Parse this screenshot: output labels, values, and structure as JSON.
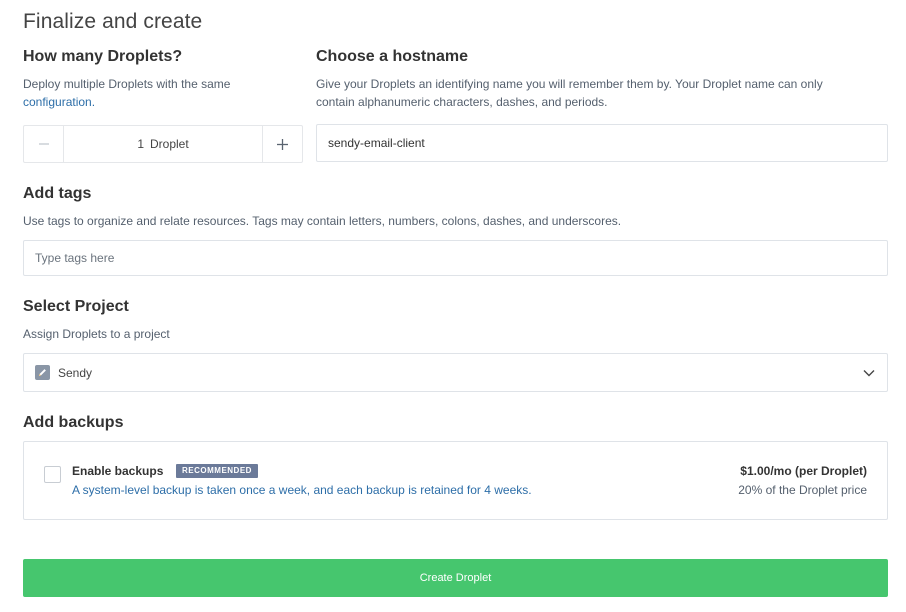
{
  "page": {
    "title": "Finalize and create"
  },
  "droplets": {
    "heading": "How many Droplets?",
    "description_prefix": "Deploy multiple Droplets with the same",
    "description_link": "configuration.",
    "minus_icon": "minus-icon",
    "plus_icon": "plus-icon",
    "count": "1",
    "unit": "Droplet"
  },
  "hostname": {
    "heading": "Choose a hostname",
    "description_line1": "Give your Droplets an identifying name you will remember them by. Your Droplet name can only",
    "description_line2": "contain alphanumeric characters, dashes, and periods.",
    "value": "sendy-email-client"
  },
  "tags": {
    "heading": "Add tags",
    "description": "Use tags to organize and relate resources. Tags may contain letters, numbers, colons, dashes, and underscores.",
    "placeholder": "Type tags here"
  },
  "project": {
    "heading": "Select Project",
    "description": "Assign Droplets to a project",
    "selected": "Sendy",
    "icon": "pencil-icon",
    "chevron": "chevron-down-icon"
  },
  "backups": {
    "heading": "Add backups",
    "checkbox_label": "Enable backups",
    "badge": "RECOMMENDED",
    "description": "A system-level backup is taken once a week, and each backup is retained for 4 weeks.",
    "price": "$1.00/mo (per Droplet)",
    "price_note": "20% of the Droplet price",
    "checked": false
  },
  "actions": {
    "create_label": "Create Droplet"
  },
  "colors": {
    "accent_green": "#46c66e",
    "link_blue": "#2d6ea8",
    "badge_bg": "#6b7a99"
  }
}
